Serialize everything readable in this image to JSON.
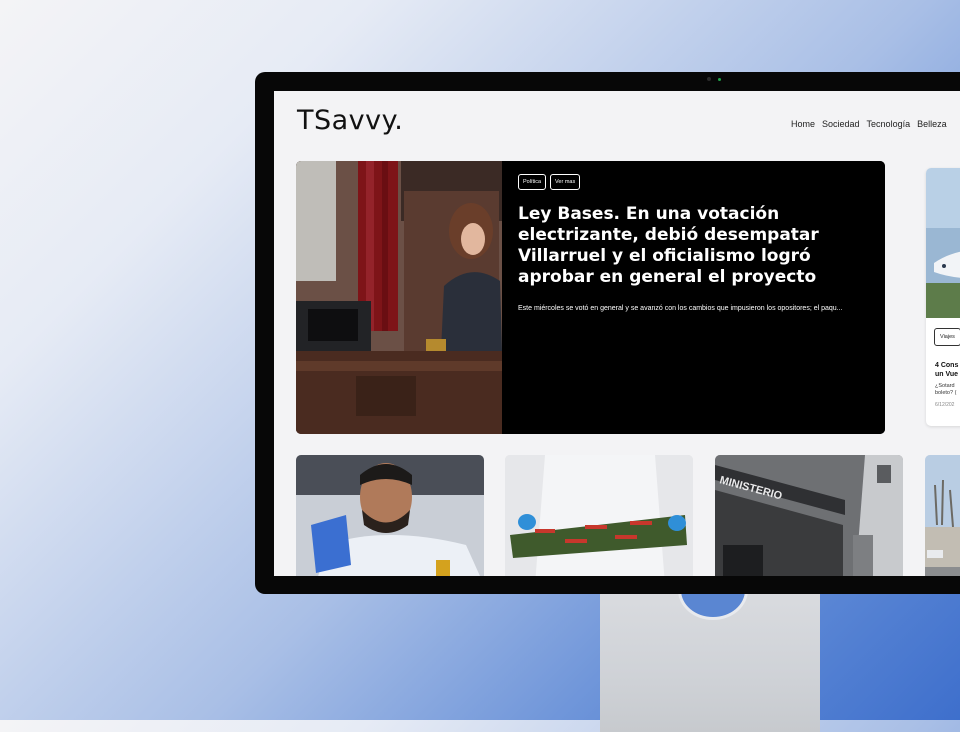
{
  "site": {
    "logo": "TSavvy.",
    "nav": [
      "Home",
      "Sociedad",
      "Tecnología",
      "Belleza"
    ]
  },
  "featured": {
    "tags": [
      "Política",
      "Ver mas"
    ],
    "title": "Ley Bases. En una votación electrizante, debió desempatar Villarruel y el oficialismo logró aprobar en general el proyecto",
    "excerpt": "Este miércoles se votó en general y se avanzó con los cambios que impusieron los opositores; el paqu..."
  },
  "side_article": {
    "tag": "Viajes",
    "title": "4 Cons\nun Vue",
    "excerpt": "¿Sotard\nboleto? (",
    "date": "6/12/202"
  },
  "colors": {
    "hero_bg": "#000000",
    "screen_bg": "#f3f3f5",
    "accent_blue": "#3e6fcc"
  }
}
